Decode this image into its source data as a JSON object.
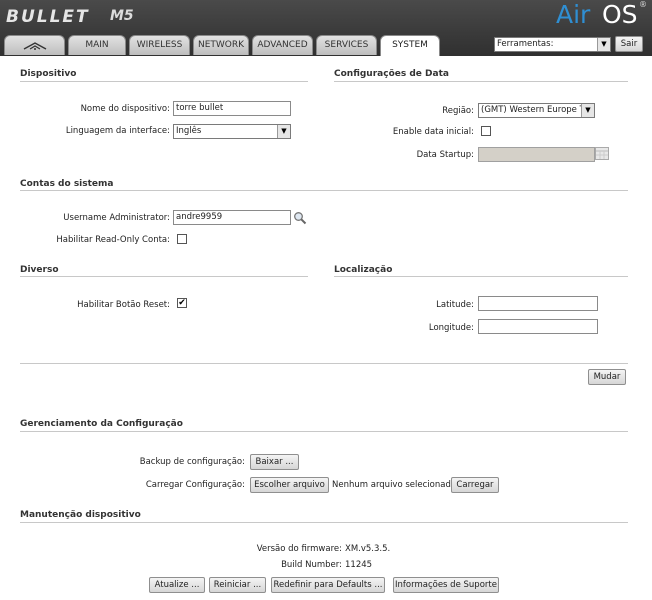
{
  "header": {
    "brand": "BULLET",
    "model": "M5",
    "os_air": "Air",
    "os_os": "OS",
    "os_reg": "®"
  },
  "tabs": {
    "logo_icon": "ubiquiti-logo-icon",
    "main": "MAIN",
    "wireless": "WIRELESS",
    "network": "NETWORK",
    "advanced": "ADVANCED",
    "services": "SERVICES",
    "system": "SYSTEM"
  },
  "tools": {
    "selected": "Ferramentas:",
    "exit_label": "Sair"
  },
  "device": {
    "title": "Dispositivo",
    "name_label": "Nome do dispositivo:",
    "name_value": "torre bullet",
    "lang_label": "Linguagem da interface:",
    "lang_value": "Inglês"
  },
  "date": {
    "title": "Configurações de Data",
    "region_label": "Região:",
    "region_value": "(GMT) Western Europe T",
    "enable_label": "Enable data inicial:",
    "enable_checked": false,
    "startup_label": "Data Startup:",
    "startup_value": ""
  },
  "accounts": {
    "title": "Contas do sistema",
    "admin_label": "Username Administrator:",
    "admin_value": "andre9959",
    "readonly_label": "Habilitar Read-Only Conta:",
    "readonly_checked": false
  },
  "misc": {
    "title": "Diverso",
    "reset_label": "Habilitar Botão Reset:",
    "reset_checked": true,
    "check_glyph": "✔"
  },
  "location": {
    "title": "Localização",
    "lat_label": "Latitude:",
    "lat_value": "",
    "lon_label": "Longitude:",
    "lon_value": ""
  },
  "change_button": "Mudar",
  "config": {
    "title": "Gerenciamento da Configuração",
    "backup_label": "Backup de configuração:",
    "backup_button": "Baixar ...",
    "upload_label": "Carregar Configuração:",
    "choose_button": "Escolher arquivo",
    "no_file": "Nenhum arquivo selecionado",
    "upload_button": "Carregar"
  },
  "maintenance": {
    "title": "Manutenção dispositivo",
    "fw_label": "Versão do firmware:",
    "fw_value": "XM.v5.3.5.",
    "build_label": "Build Number:",
    "build_value": "11245",
    "update_button": "Atualize ...",
    "reboot_button": "Reiniciar ...",
    "reset_button": "Redefinir para Defaults ...",
    "support_button": "Informações de Suporte"
  },
  "colors": {
    "header_bg": "#3a3a3a",
    "air_blue": "#2f8fd3",
    "rule": "#c8c8c8"
  }
}
